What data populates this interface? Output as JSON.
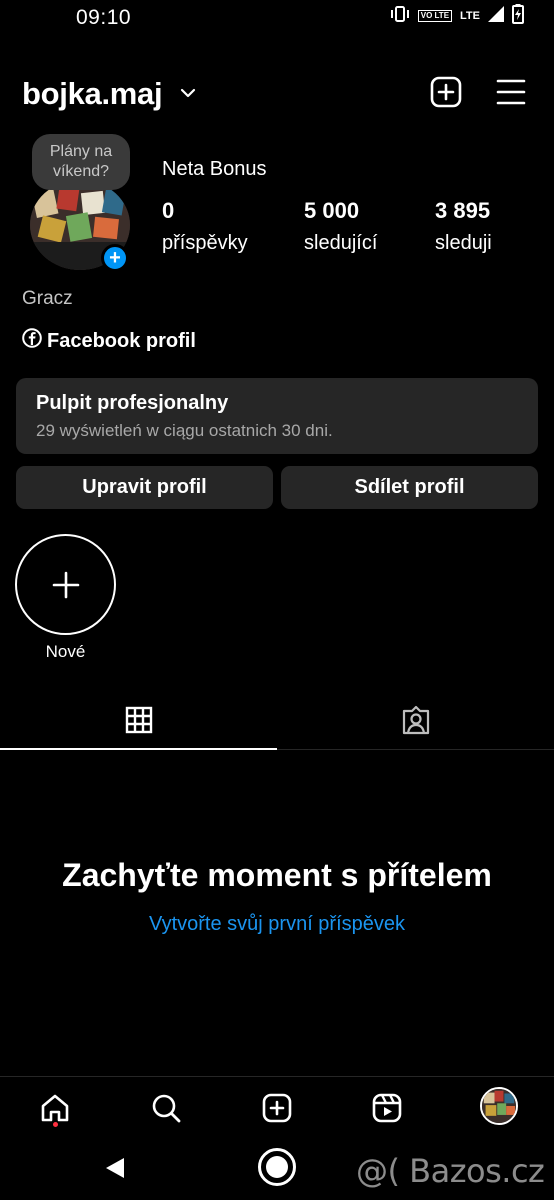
{
  "status_bar": {
    "time": "09:10",
    "volte_label": "VO LTE",
    "network_label": "LTE",
    "icons": [
      "vibrate-icon",
      "volte-icon",
      "lte-signal-icon",
      "signal-icon",
      "battery-charging-icon"
    ]
  },
  "header": {
    "username": "bojka.maj",
    "icons": [
      "chevron-down-icon",
      "create-plus-icon",
      "menu-icon"
    ]
  },
  "profile": {
    "note": "Plány na víkend?",
    "display_name": "Neta Bonus",
    "stats": [
      {
        "value": "0",
        "label": "příspěvky"
      },
      {
        "value": "5 000",
        "label": "sledující"
      },
      {
        "value": "3 895",
        "label": "sleduji"
      }
    ],
    "bio_name": "Gracz",
    "facebook_link": "Facebook profil"
  },
  "dashboard": {
    "title": "Pulpit profesjonalny",
    "subtitle": "29 wyświetleń w ciągu ostatnich 30 dni."
  },
  "buttons": {
    "edit_profile": "Upravit profil",
    "share_profile": "Sdílet profil"
  },
  "highlights": {
    "new_label": "Nové"
  },
  "empty_state": {
    "title": "Zachyťte moment s přítelem",
    "link": "Vytvořte svůj první příspěvek"
  },
  "bottom_nav": {
    "items": [
      "home-icon",
      "search-icon",
      "create-icon",
      "reels-icon",
      "profile-avatar"
    ],
    "active": "home-icon"
  },
  "watermark": "@( Bazos.cz",
  "colors": {
    "background": "#000000",
    "surface": "#262626",
    "accent_blue": "#0095f6",
    "link_blue": "#1b95f0",
    "notification_dot": "#ff3040"
  }
}
